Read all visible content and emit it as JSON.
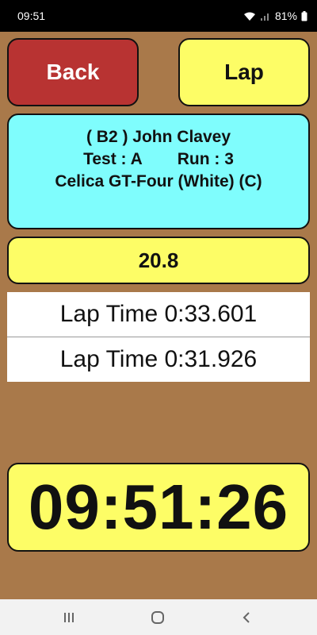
{
  "status": {
    "time": "09:51",
    "battery": "81%"
  },
  "buttons": {
    "back_label": "Back",
    "lap_label": "Lap"
  },
  "driver": {
    "line1": "( B2 ) John Clavey",
    "test": "Test : A",
    "run": "Run : 3",
    "car": "Celica GT-Four (White) (C)"
  },
  "speed": "20.8",
  "laps": [
    {
      "text": "Lap Time 0:33.601"
    },
    {
      "text": "Lap Time 0:31.926"
    }
  ],
  "clock": "09:51:26",
  "colors": {
    "background": "#a9794a",
    "back_button": "#b83332",
    "yellow": "#fdfd66",
    "cyan": "#7ffdfd"
  },
  "nav": {
    "recents_icon": "recents-icon",
    "home_icon": "home-icon",
    "back_icon": "back-chevron-icon"
  }
}
